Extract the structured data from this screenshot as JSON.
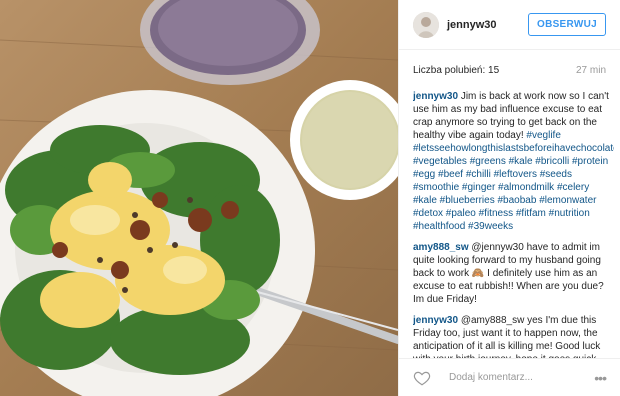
{
  "header": {
    "username": "jennyw30",
    "follow_label": "OBSERWUJ"
  },
  "meta": {
    "likes": "Liczba polubień: 15",
    "time": "27 min"
  },
  "comments": [
    {
      "author": "jennyw30",
      "text": "Jim is back at work now so I can't use him as my bad influence excuse to eat crap anymore so trying to get back on the healthy vibe again today!",
      "tags": "#veglife #letsseehowlongthislastsbeforeihavechocolate #vegetables #greens #kale #bricolli #protein #egg #beef #chilli #leftovers #seeds #smoothie #ginger #almondmilk #celery #kale #blueberries #baobab #lemonwater #detox #paleo #fitness #fitfam #nutrition #healthfood #39weeks"
    },
    {
      "author": "amy888_sw",
      "text": "@jennyw30 have to admit im quite looking forward to my husband going back to work 🙈 I definitely use him as an excuse to eat rubbish!! When are you due? Im due Friday!"
    },
    {
      "author": "jennyw30",
      "text": "@amy888_sw yes I'm due this Friday too, just want it to happen now, the anticipation of it all is killing me! Good luck with your birth journey, hope it goes quick and smoothly for you x"
    }
  ],
  "footer": {
    "add_comment_placeholder": "Dodaj komentarz...",
    "more_label": "•••"
  },
  "icons": {
    "heart": "heart-icon",
    "more": "more-options-icon"
  }
}
